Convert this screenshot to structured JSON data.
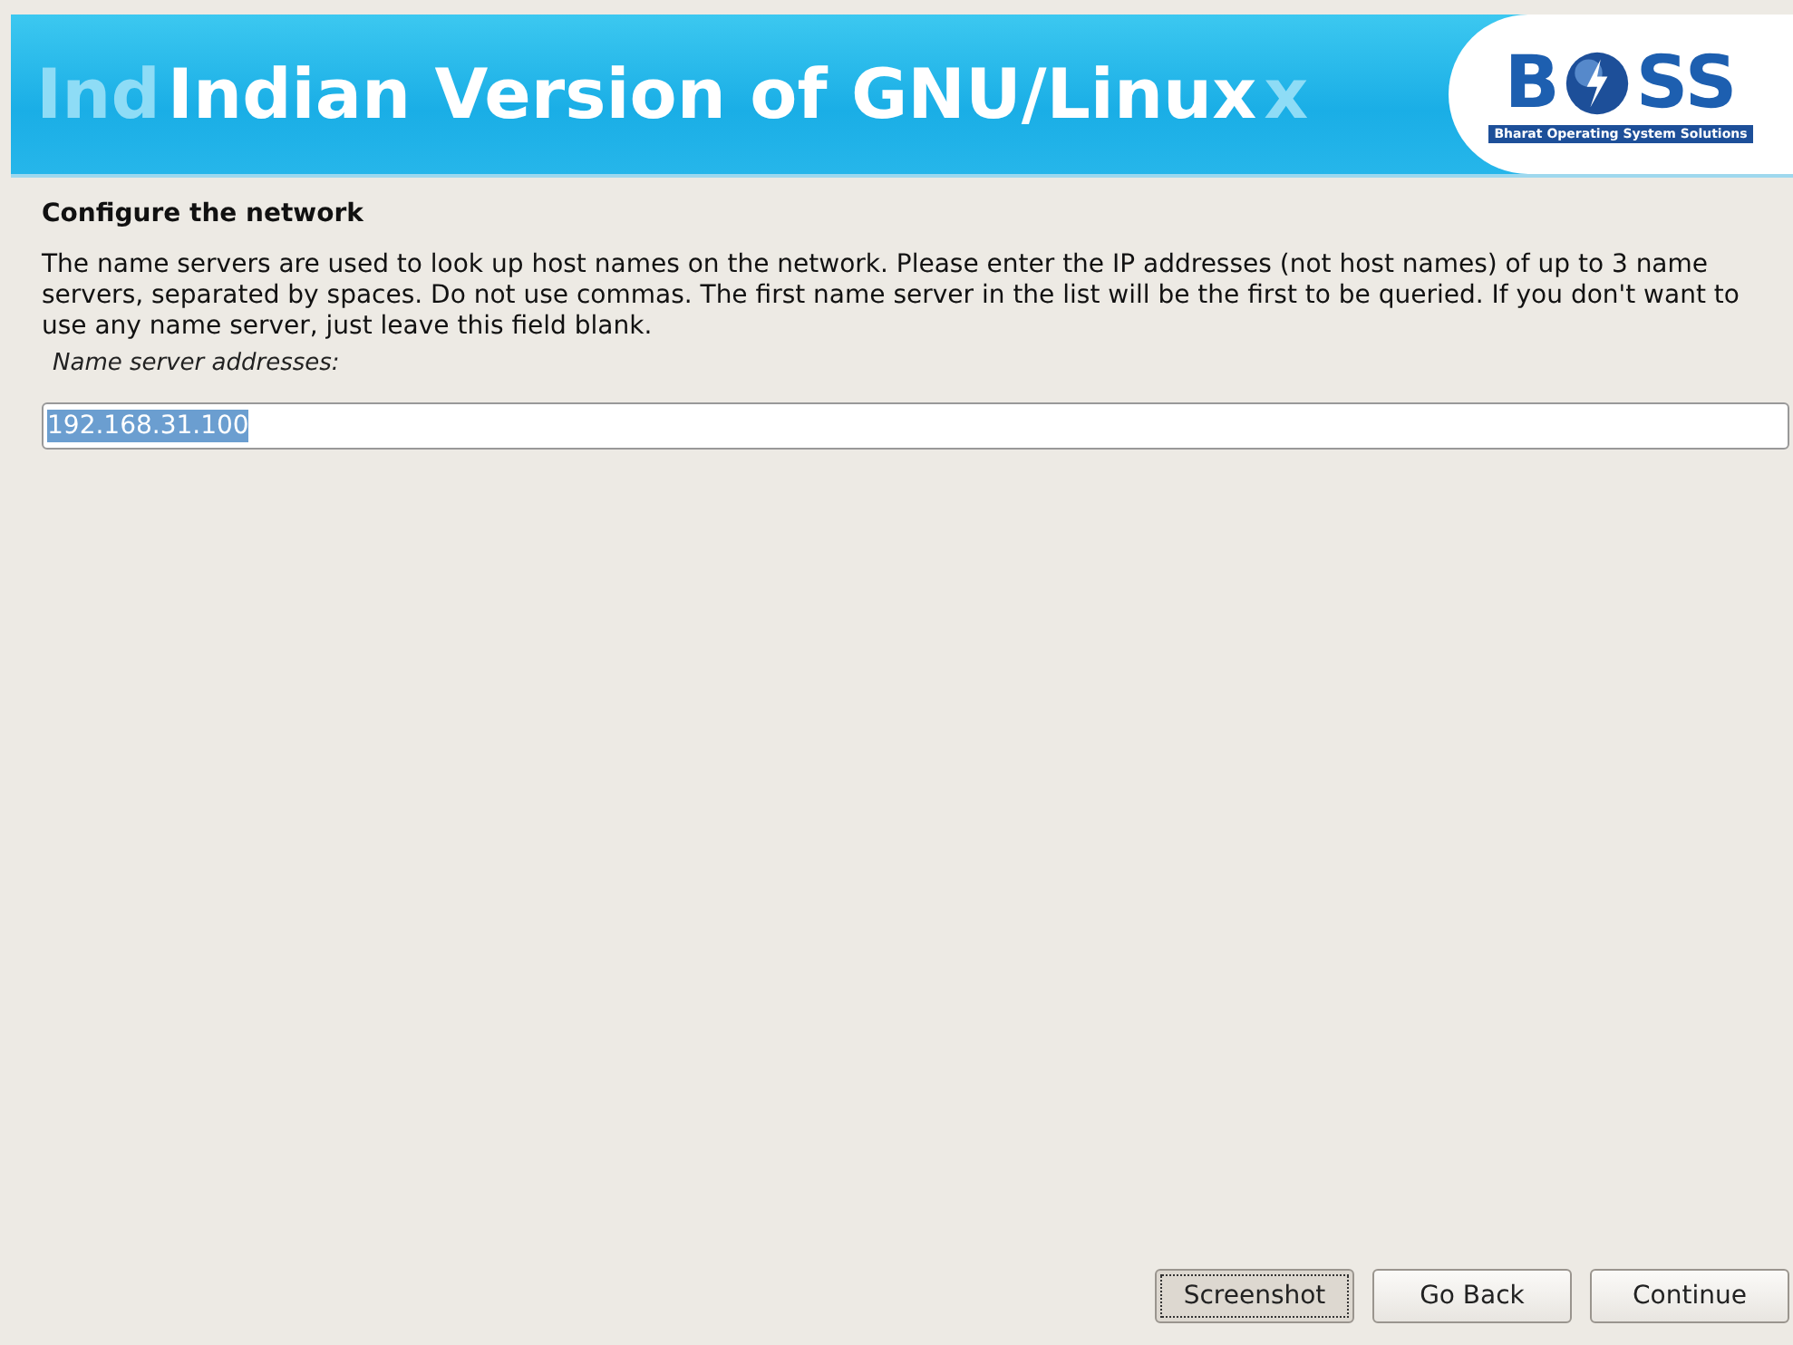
{
  "banner": {
    "title": "Indian Version of GNU/Linux",
    "ghost_left": "Ind",
    "ghost_right": "x",
    "logo": {
      "left": "B",
      "right": "SS",
      "tagline": "Bharat Operating System Solutions"
    }
  },
  "page": {
    "heading": "Configure the network",
    "description": "The name servers are used to look up host names on the network. Please enter the IP addresses (not host names) of up to 3 name servers, separated by spaces. Do not use commas. The first name server in the list will be the first to be queried. If you don't want to use any name server, just leave this field blank.",
    "field_label": "Name server addresses:",
    "field_value": "192.168.31.100",
    "value_selected": true
  },
  "buttons": [
    {
      "label": "Screenshot",
      "focused": true
    },
    {
      "label": "Go Back",
      "focused": false
    },
    {
      "label": "Continue",
      "focused": false
    }
  ]
}
